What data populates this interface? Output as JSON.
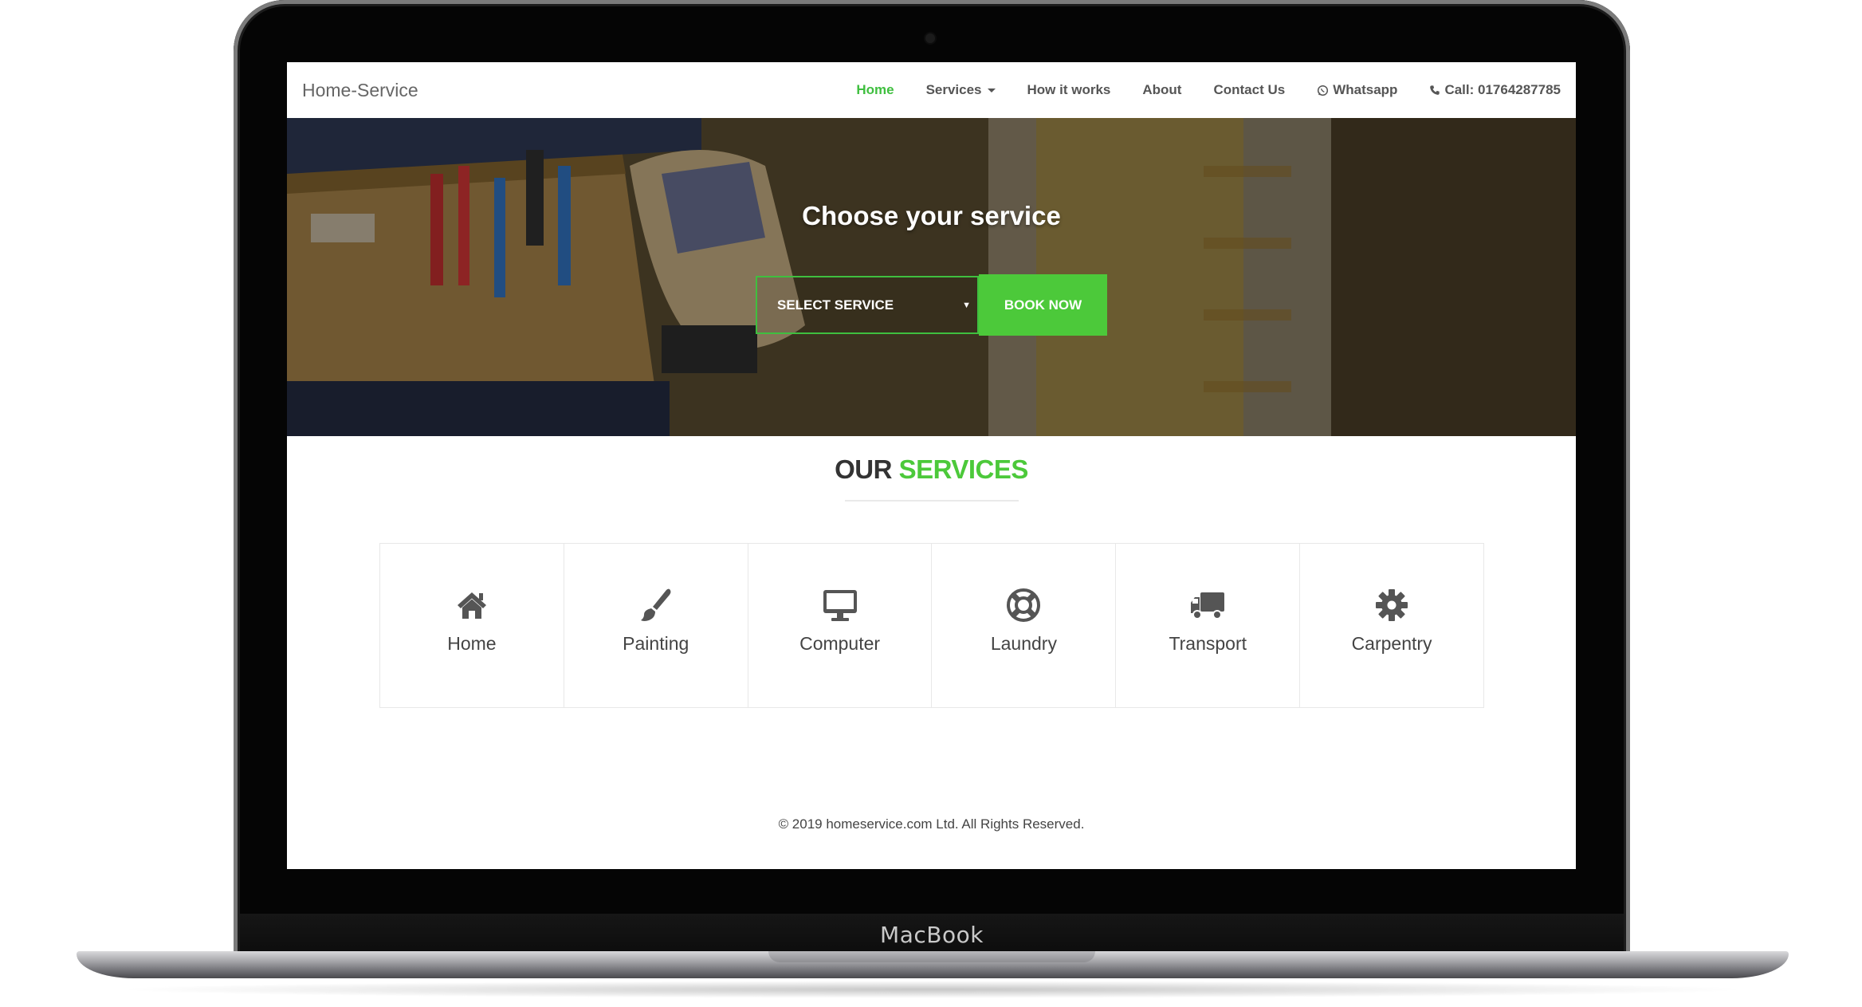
{
  "device": {
    "brand": "MacBook"
  },
  "navbar": {
    "logo": "Home-Service",
    "links": [
      {
        "label": "Home",
        "active": true
      },
      {
        "label": "Services",
        "dropdown": true
      },
      {
        "label": "How it works"
      },
      {
        "label": "About"
      },
      {
        "label": "Contact Us"
      },
      {
        "label": "Whatsapp",
        "icon": "whatsapp-icon"
      },
      {
        "label": "Call: 01764287785",
        "icon": "phone-icon"
      }
    ]
  },
  "hero": {
    "title": "Choose your service",
    "select": {
      "value": "SELECT SERVICE"
    },
    "button": "BOOK NOW"
  },
  "services_section": {
    "title_dark": "OUR",
    "title_accent": "SERVICES",
    "items": [
      {
        "label": "Home",
        "icon": "home-icon"
      },
      {
        "label": "Painting",
        "icon": "paint-brush-icon"
      },
      {
        "label": "Computer",
        "icon": "desktop-icon"
      },
      {
        "label": "Laundry",
        "icon": "life-ring-icon"
      },
      {
        "label": "Transport",
        "icon": "truck-icon"
      },
      {
        "label": "Carpentry",
        "icon": "gear-icon"
      }
    ]
  },
  "footer": {
    "copyright": "© 2019 homeservice.com Ltd. All Rights Reserved."
  },
  "colors": {
    "accent": "#4cc93a",
    "text": "#444444",
    "nav_text": "#555555"
  }
}
